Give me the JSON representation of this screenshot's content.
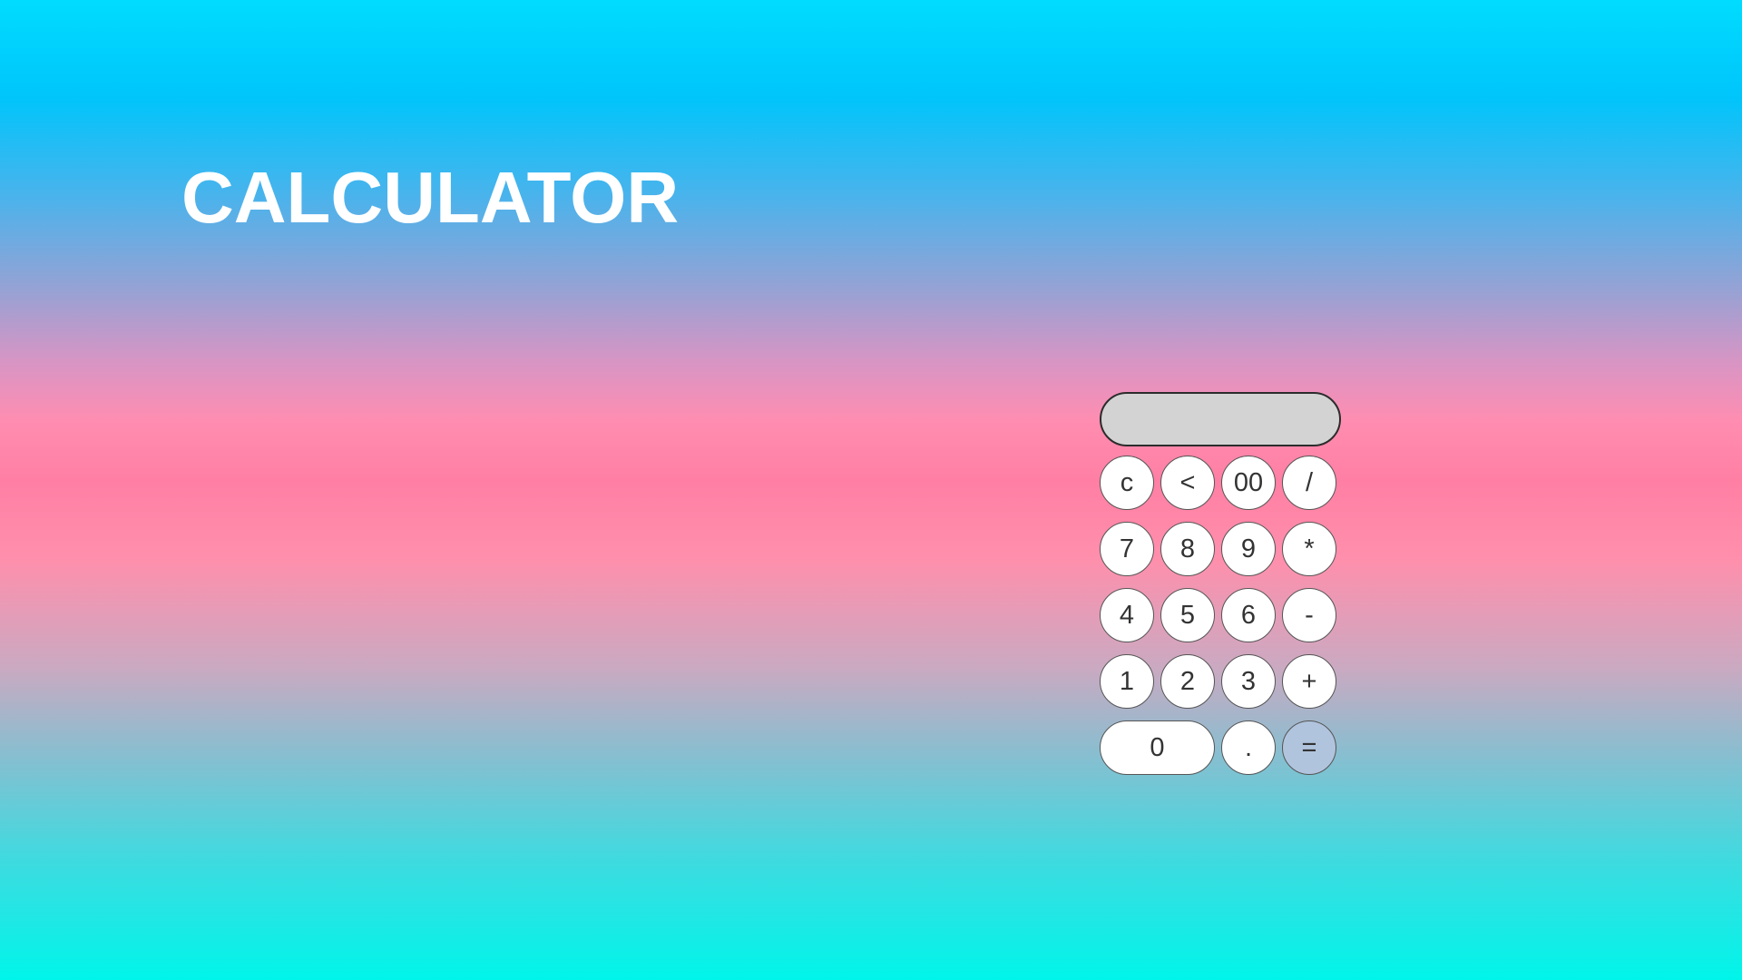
{
  "page": {
    "title": "CALCULATOR"
  },
  "calculator": {
    "display_value": "",
    "keys": [
      {
        "label": "c",
        "name": "clear-button"
      },
      {
        "label": "<",
        "name": "backspace-button"
      },
      {
        "label": "00",
        "name": "double-zero-button"
      },
      {
        "label": "/",
        "name": "divide-button"
      },
      {
        "label": "7",
        "name": "digit-7-button"
      },
      {
        "label": "8",
        "name": "digit-8-button"
      },
      {
        "label": "9",
        "name": "digit-9-button"
      },
      {
        "label": "*",
        "name": "multiply-button"
      },
      {
        "label": "4",
        "name": "digit-4-button"
      },
      {
        "label": "5",
        "name": "digit-5-button"
      },
      {
        "label": "6",
        "name": "digit-6-button"
      },
      {
        "label": "-",
        "name": "subtract-button"
      },
      {
        "label": "1",
        "name": "digit-1-button"
      },
      {
        "label": "2",
        "name": "digit-2-button"
      },
      {
        "label": "3",
        "name": "digit-3-button"
      },
      {
        "label": "+",
        "name": "add-button"
      },
      {
        "label": "0",
        "name": "digit-0-button"
      },
      {
        "label": ".",
        "name": "decimal-button"
      },
      {
        "label": "=",
        "name": "equals-button"
      }
    ]
  },
  "colors": {
    "display_background": "#d3d3d3",
    "key_background": "#ffffff",
    "equals_background": "#b0c4de",
    "title_text": "#ffffff"
  }
}
